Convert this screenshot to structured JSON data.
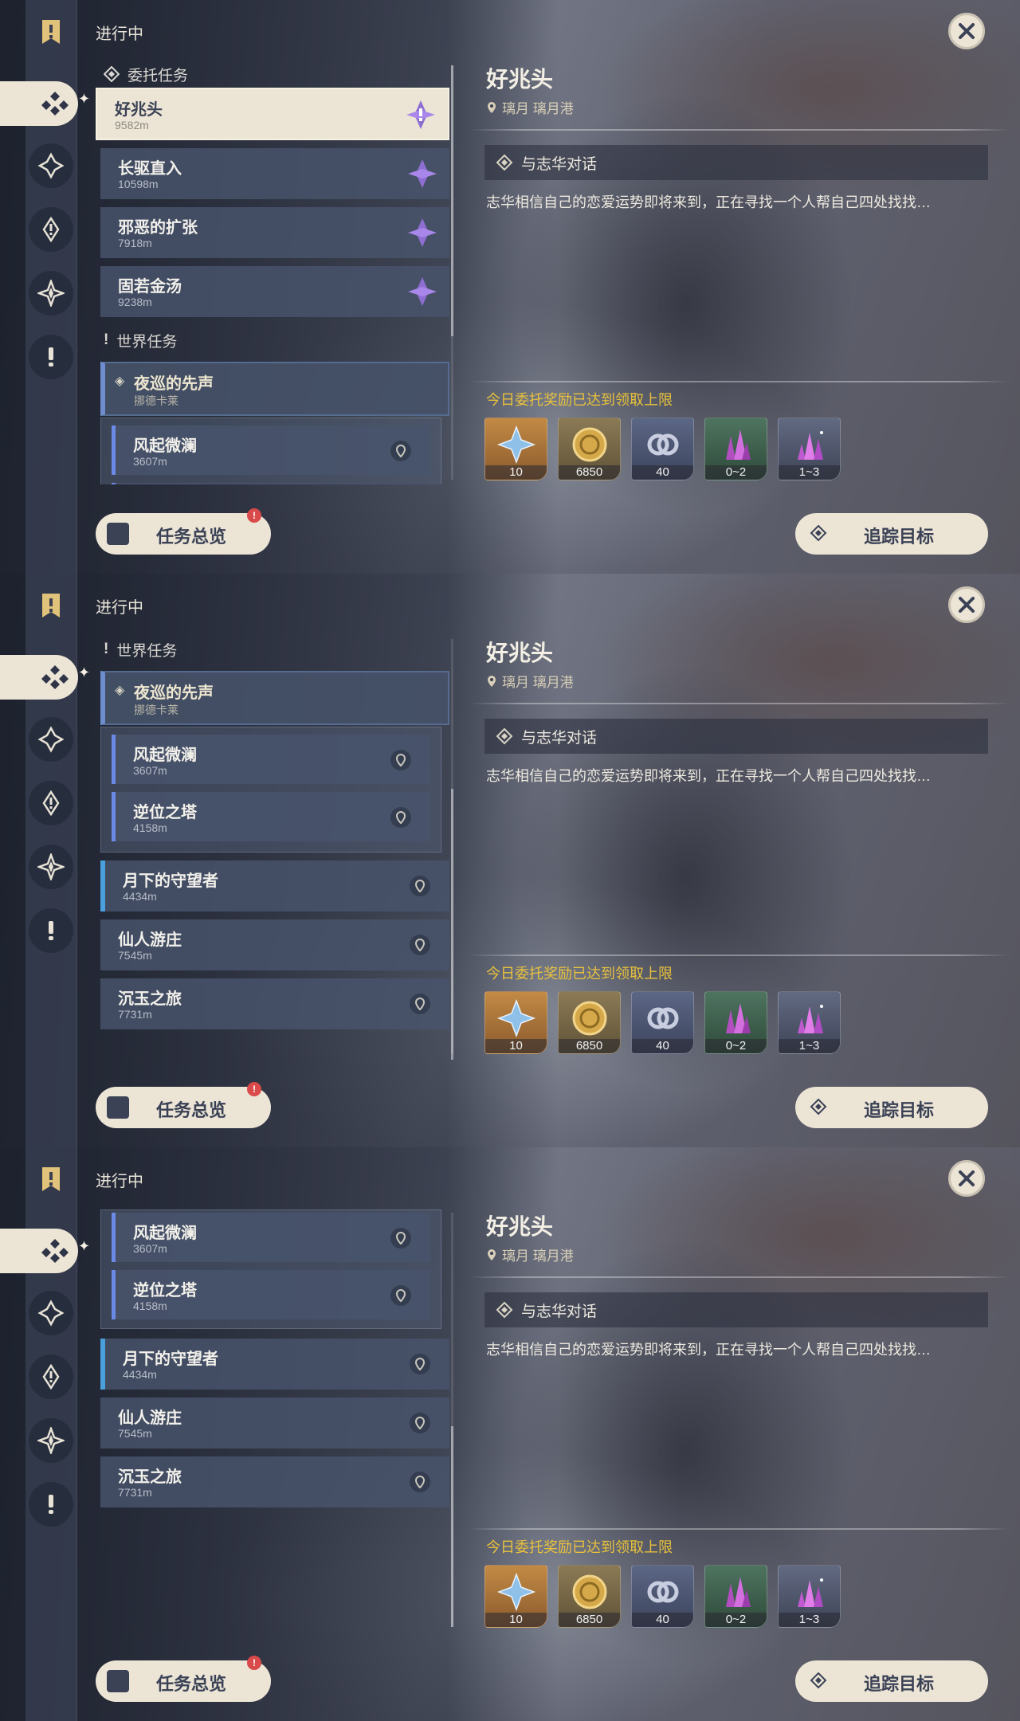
{
  "header": {
    "title": "进行中"
  },
  "sections": {
    "commission": "委托任务",
    "world": "世界任务"
  },
  "commissions": [
    {
      "title": "好兆头",
      "dist": "9582m"
    },
    {
      "title": "长驱直入",
      "dist": "10598m"
    },
    {
      "title": "邪恶的扩张",
      "dist": "7918m"
    },
    {
      "title": "固若金汤",
      "dist": "9238m"
    }
  ],
  "world_main": {
    "title": "夜巡的先声",
    "sub": "挪德卡莱"
  },
  "world_subs": [
    {
      "title": "风起微澜",
      "dist": "3607m"
    },
    {
      "title": "逆位之塔",
      "dist": "4158m"
    }
  ],
  "world_others": [
    {
      "title": "月下的守望者",
      "dist": "4434m"
    },
    {
      "title": "仙人游庄",
      "dist": "7545m"
    },
    {
      "title": "沉玉之旅",
      "dist": "7731m"
    }
  ],
  "detail": {
    "title": "好兆头",
    "location": "璃月 璃月港",
    "objective": "与志华对话",
    "description": "志华相信自己的恋爱运势即将来到，正在寻找一个人帮自己四处找找…",
    "limit_notice": "今日委托奖励已达到领取上限",
    "rewards": [
      {
        "icon": "adventure-exp-icon",
        "count": "10",
        "color": "#b4773a"
      },
      {
        "icon": "mora-icon",
        "count": "6850",
        "color": "#a27f3e"
      },
      {
        "icon": "friendship-exp-icon",
        "count": "40",
        "color": "#55617d"
      },
      {
        "icon": "crystal-icon",
        "count": "0~2",
        "color": "#4f6f5c"
      },
      {
        "icon": "primogem-shard-icon",
        "count": "1~3",
        "color": "#5b6074"
      }
    ]
  },
  "buttons": {
    "overview": "任务总览",
    "overview_badge": "!",
    "track": "追踪目标"
  }
}
